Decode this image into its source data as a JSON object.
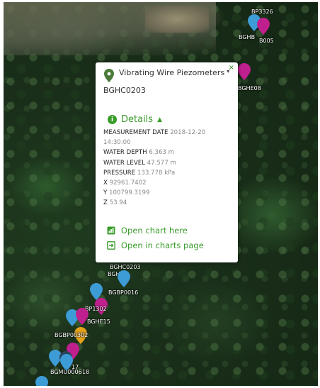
{
  "popup": {
    "close_icon": "×",
    "layer_name": "Vibrating Wire Piezometers",
    "dropdown_caret": "▾",
    "station_id": "BGHC0203",
    "details_toggle": "Details",
    "details_icon": "i",
    "details_chevron": "▲",
    "fields": {
      "measurement_date_label": "MEASUREMENT DATE",
      "measurement_date_value": "2018-12-20 14:30:00",
      "water_depth_label": "WATER DEPTH",
      "water_depth_value": "6.363 m",
      "water_level_label": "WATER LEVEL",
      "water_level_value": "47.577 m",
      "pressure_label": "PRESSURE",
      "pressure_value": "133.778 kPa",
      "x_label": "X",
      "x_value": "92961.7402",
      "y_label": "Y",
      "y_value": "100799.3199",
      "z_label": "Z",
      "z_value": "53.94"
    },
    "open_chart_here": "Open chart here",
    "open_in_charts_page": "Open in charts page"
  },
  "map_labels": {
    "bp3326": "BP3326",
    "bghb_top": "BGHB",
    "top_right_2": "B005",
    "bghe08": "BGHE08",
    "bghc0203": "BGHC0203",
    "bghb_mid": "BGHB",
    "bgbp0016": "BGBP0016",
    "bp1302": "BP1302",
    "bghe15": "BGHE15",
    "bgbp_low": "BGBP00302",
    "bottom_1": "17",
    "bottom_2": "BGMU0006",
    "bottom_3": "18"
  },
  "colors": {
    "accent_green": "#3a9c2b",
    "pin_blue": "#3d9bd6",
    "pin_magenta": "#c01f8e",
    "pin_orange": "#e3a21c"
  },
  "icons": {
    "layer_pin": "map-pin-icon",
    "chart": "bar-chart-icon",
    "external": "open-external-icon"
  }
}
